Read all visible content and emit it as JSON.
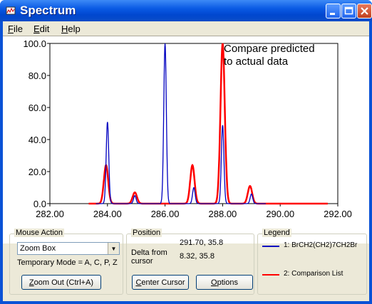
{
  "window": {
    "title": "Spectrum"
  },
  "menu": [
    {
      "label": "File",
      "underline": "F",
      "rest": "ile"
    },
    {
      "label": "Edit",
      "underline": "E",
      "rest": "dit"
    },
    {
      "label": "Help",
      "underline": "H",
      "rest": "elp"
    }
  ],
  "chart_data": {
    "type": "line",
    "annotation": [
      "Compare predicted",
      "to actual data"
    ],
    "xlim": [
      282.0,
      292.0
    ],
    "ylim": [
      0.0,
      100.0
    ],
    "x_ticks": [
      "282.00",
      "284.00",
      "286.00",
      "288.00",
      "290.00",
      "292.00"
    ],
    "y_ticks": [
      "0.0",
      "20.0",
      "40.0",
      "60.0",
      "80.0",
      "100.0"
    ],
    "grid": false,
    "series": [
      {
        "name": "1: BrCH2(CH2)7CH2Br",
        "color": "#0000c0",
        "peaks": [
          {
            "x": 284.0,
            "y": 51
          },
          {
            "x": 284.95,
            "y": 5
          },
          {
            "x": 286.0,
            "y": 100
          },
          {
            "x": 287.0,
            "y": 10
          },
          {
            "x": 288.0,
            "y": 49
          },
          {
            "x": 289.0,
            "y": 6
          }
        ]
      },
      {
        "name": "2: Comparison List",
        "color": "#ff0000",
        "peaks": [
          {
            "x": 283.95,
            "y": 24
          },
          {
            "x": 284.95,
            "y": 7
          },
          {
            "x": 286.95,
            "y": 24
          },
          {
            "x": 288.0,
            "y": 100
          },
          {
            "x": 288.95,
            "y": 11
          }
        ]
      }
    ]
  },
  "mouse_action": {
    "title": "Mouse Action",
    "mode_value": "Zoom Box",
    "temporary_mode": "Temporary Mode = A, C, P, Z",
    "zoom_out": {
      "label": "Zoom Out (Ctrl+A)",
      "underline": "Z",
      "rest": "oom Out (Ctrl+A)"
    }
  },
  "position": {
    "title": "Position",
    "cursor_value": "291.70, 35.8",
    "delta_label_1": "Delta from",
    "delta_label_2": "cursor",
    "delta_value": "8.32, 35.8",
    "center_cursor": {
      "label": "Center Cursor",
      "underline": "C",
      "rest": "enter Cursor"
    },
    "options": {
      "label": "Options",
      "underline": "O",
      "rest": "ptions"
    }
  },
  "legend": {
    "title": "Legend",
    "items": [
      {
        "label": "1: BrCH2(CH2)7CH2Br",
        "color": "#0000c0"
      },
      {
        "label": "2: Comparison List",
        "color": "#ff0000"
      }
    ]
  }
}
